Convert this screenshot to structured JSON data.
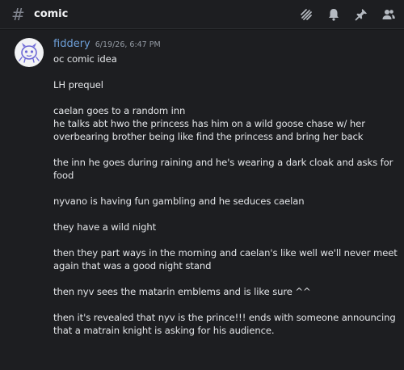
{
  "channel": {
    "hash_glyph": "#",
    "name": "comic"
  },
  "header_icons": [
    "threads-icon",
    "bell-icon",
    "pin-icon",
    "members-icon"
  ],
  "message": {
    "author": "fiddery",
    "timestamp": "6/19/26, 6:47 PM",
    "lines": [
      "oc comic idea",
      "",
      "LH prequel",
      "",
      "caelan goes to a random inn",
      "he talks abt hwo the princess has him on a wild goose chase w/ her",
      "overbearing brother being like find the princess and bring her back",
      "",
      "the inn he goes during raining and he's wearing a dark cloak and asks for",
      "food",
      "",
      "nyvano is having fun gambling and he seduces caelan",
      "",
      "they have a wild night",
      "",
      "then they part ways in the morning and caelan's like well we'll never meet",
      "again that was a good night stand",
      "",
      "then nyv sees the matarin emblems and is like sure ^^",
      "",
      "then it's revealed that nyv is the prince!!! ends with someone announcing",
      "that a matrain knight is asking for his audience."
    ]
  },
  "colors": {
    "background": "#1d1e21",
    "username": "#6d9fd8",
    "text": "#e3e5e8",
    "muted": "#949ba4"
  }
}
